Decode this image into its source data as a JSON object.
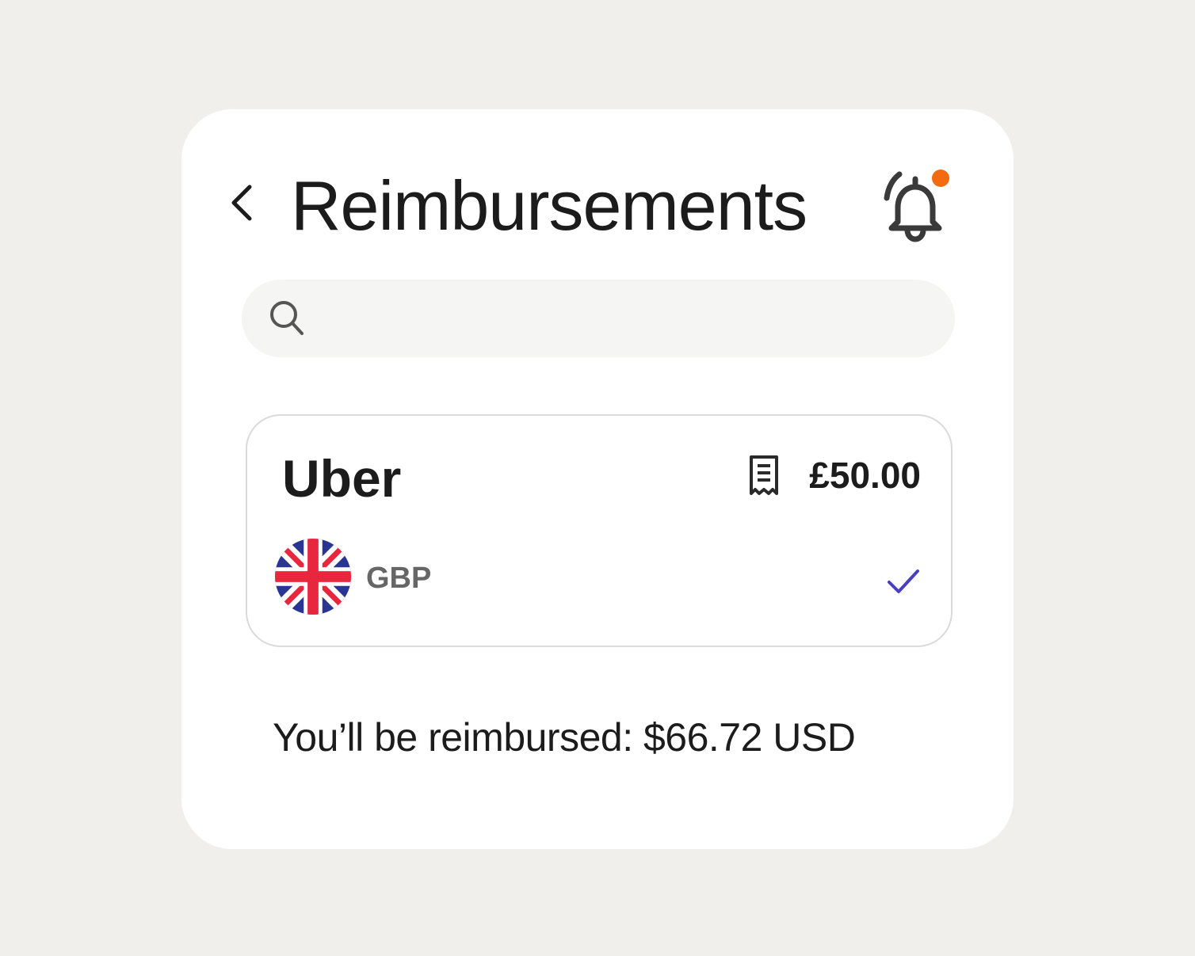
{
  "header": {
    "title": "Reimbursements",
    "back_icon": "chevron-left-icon",
    "notification_icon": "bell-icon",
    "notification_dot_color": "#f36a10"
  },
  "search": {
    "icon": "search-icon",
    "value": "",
    "placeholder": ""
  },
  "expense": {
    "merchant": "Uber",
    "receipt_icon": "receipt-icon",
    "amount": "£50.00",
    "currency_code": "GBP",
    "flag_icon": "uk-flag-icon",
    "status_icon": "checkmark-icon",
    "status_color": "#4a3fbf"
  },
  "summary": {
    "text": "You’ll be reimbursed: $66.72 USD"
  }
}
